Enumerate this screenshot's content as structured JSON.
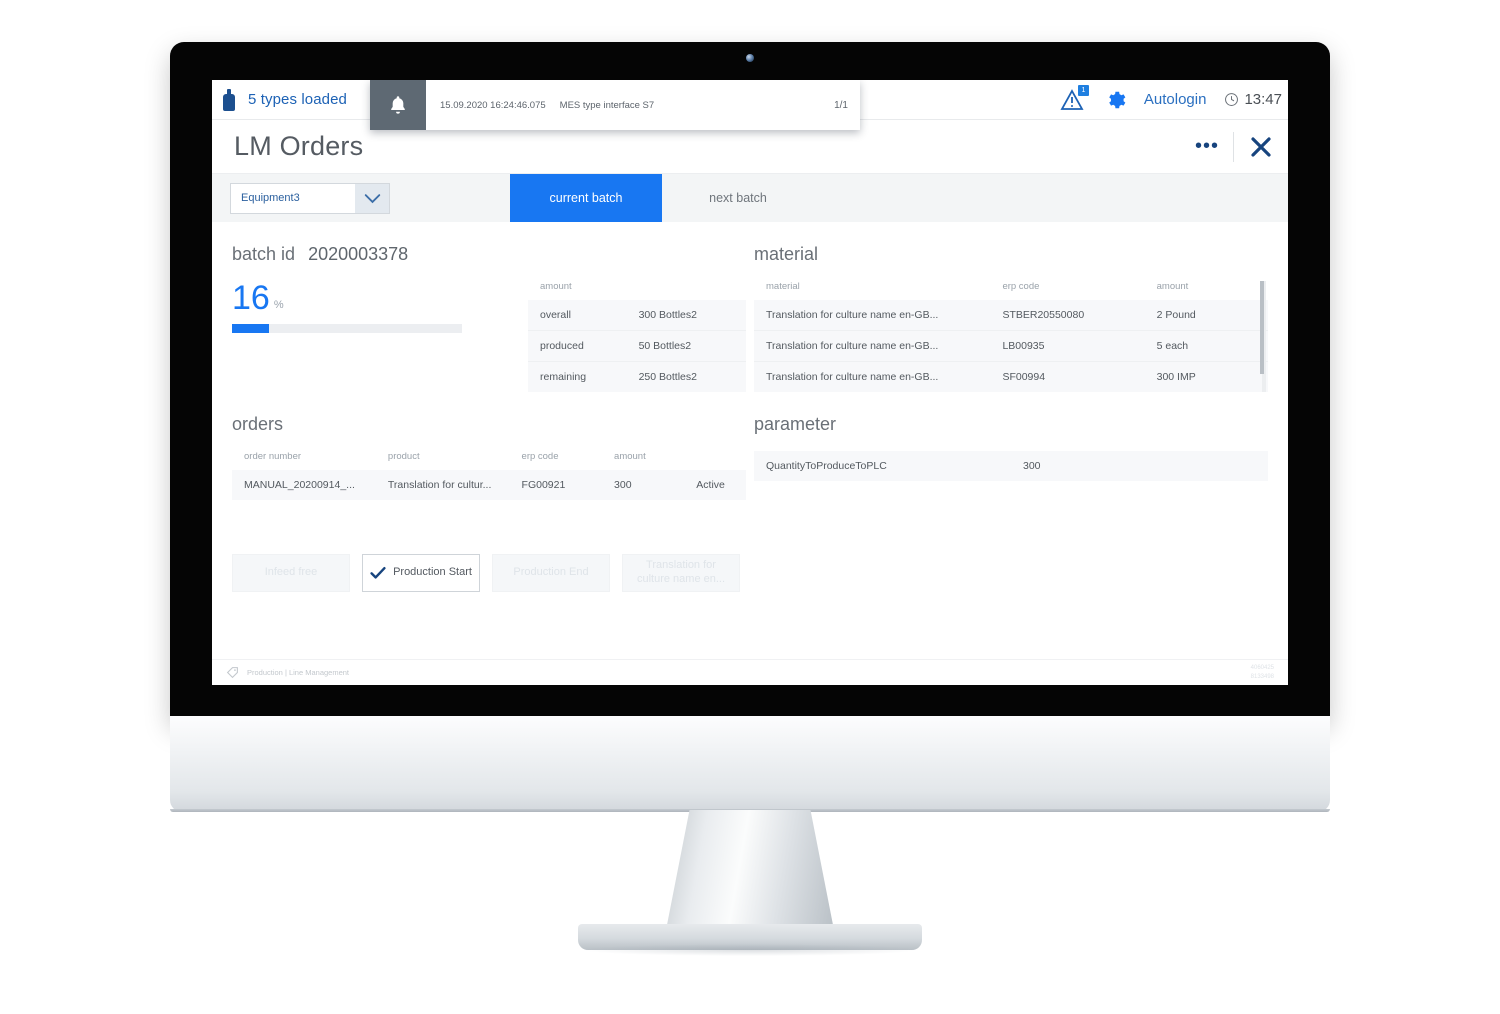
{
  "topbar": {
    "bottle_icon": "bottle-icon",
    "types_loaded": "5 types loaded",
    "warning_badge": "1",
    "autologin": "Autologin",
    "time": "13:47"
  },
  "toast": {
    "bell_icon": "bell-icon",
    "timestamp": "15.09.2020 16:24:46.075",
    "message": "MES type interface S7",
    "count": "1/1"
  },
  "titlebar": {
    "title": "LM Orders",
    "more_label": "•••",
    "close_label": "✕"
  },
  "toolbar": {
    "equipment_value": "Equipment3",
    "equipment_placeholder": "Equipment",
    "tabs": [
      {
        "label": "current batch",
        "active": true
      },
      {
        "label": "next batch",
        "active": false
      }
    ]
  },
  "batch": {
    "label": "batch id",
    "id": "2020003378",
    "progress_value": "16",
    "progress_sign": "%",
    "progress_percent": 16
  },
  "amount_table": {
    "header": "amount",
    "rows": [
      {
        "label": "overall",
        "value": "300 Bottles2"
      },
      {
        "label": "produced",
        "value": "50 Bottles2"
      },
      {
        "label": "remaining",
        "value": "250 Bottles2"
      }
    ]
  },
  "material": {
    "title": "material",
    "columns": [
      "material",
      "erp code",
      "amount"
    ],
    "rows": [
      {
        "material": "Translation for culture name en-GB...",
        "erp_code": "STBER20550080",
        "amount": "2 Pound"
      },
      {
        "material": "Translation for culture name en-GB...",
        "erp_code": "LB00935",
        "amount": "5 each"
      },
      {
        "material": "Translation for culture name en-GB...",
        "erp_code": "SF00994",
        "amount": "300 IMP"
      }
    ]
  },
  "orders": {
    "title": "orders",
    "columns": [
      "order number",
      "product",
      "erp code",
      "amount",
      ""
    ],
    "rows": [
      {
        "order_number": "MANUAL_20200914_...",
        "product": "Translation for cultur...",
        "erp_code": "FG00921",
        "amount": "300",
        "status": "Active"
      }
    ]
  },
  "parameter": {
    "title": "parameter",
    "rows": [
      {
        "name": "QuantityToProduceToPLC",
        "value": "300"
      }
    ]
  },
  "buttons": [
    {
      "label": "Infeed free",
      "enabled": false,
      "check": false
    },
    {
      "label": "Production Start",
      "enabled": true,
      "check": true
    },
    {
      "label": "Production End",
      "enabled": false,
      "check": false
    },
    {
      "label": "Translation for culture name en...",
      "enabled": false,
      "check": false
    }
  ],
  "footer": {
    "tag_icon": "tag-icon",
    "text": "Production | Line Management",
    "version": "4060425\n8133498"
  },
  "colors": {
    "accent": "#1877f2",
    "link": "#1d62b5",
    "bezel": "#050505",
    "toolbar_bg": "#f3f5f6",
    "row_bg": "#f7f8fa"
  }
}
